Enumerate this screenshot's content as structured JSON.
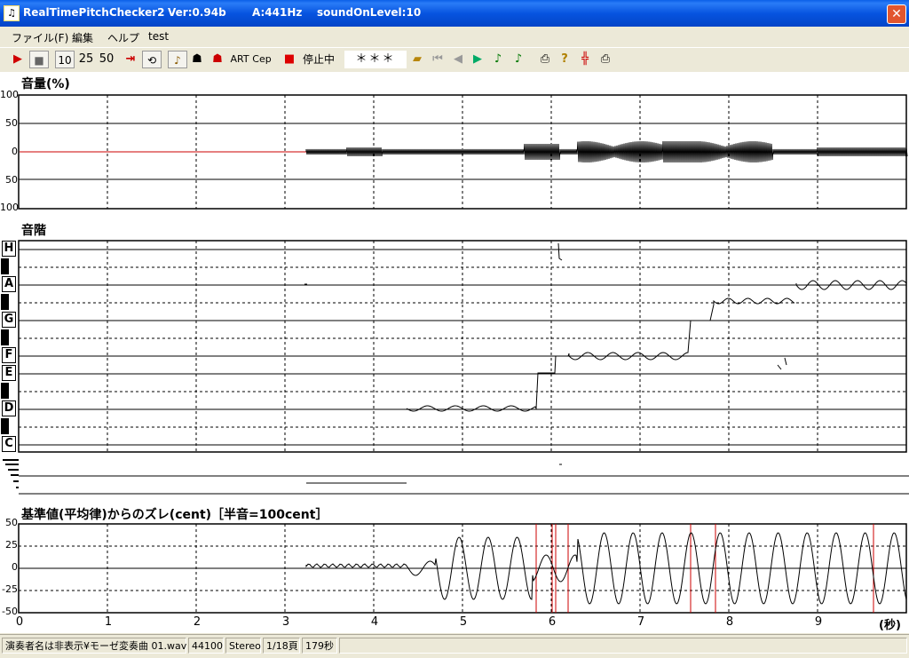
{
  "window": {
    "app_name": "RealTimePitchChecker2",
    "version": "Ver:0.94b",
    "a_freq": "A:441Hz",
    "sound_level": "soundOnLevel:10",
    "close_symbol": "✕"
  },
  "menu": [
    "ファイル(F)",
    "編集",
    "ヘルプ",
    "test"
  ],
  "toolbar": {
    "play_symbol": "▶",
    "stop_symbol": "■",
    "zoom_10": "10",
    "zoom_25": "25",
    "zoom_50": "50",
    "art_label": "ART",
    "cep_label": "Cep",
    "status_label": "停止中",
    "note_display": "＊＊＊",
    "icons": [
      "jump-end-icon",
      "loop-icon",
      "violin-icon",
      "singer-icon",
      "singer-red-icon",
      "record-icon",
      "folder-icon",
      "first-icon",
      "prev-icon",
      "next-icon",
      "note-green-icon",
      "note-green2-icon",
      "print-icon",
      "help-icon",
      "split-icon",
      "print2-icon"
    ]
  },
  "volume_panel": {
    "title": "音量(%)",
    "yticks": [
      "100",
      "50",
      "0",
      "50",
      "100"
    ]
  },
  "scale_panel": {
    "title": "音階",
    "notes": [
      "H",
      "A",
      "G",
      "F",
      "E",
      "D",
      "C"
    ]
  },
  "deviation_panel": {
    "title": "基準値(平均律)からのズレ(cent)［半音=100cent］",
    "yticks": [
      "50",
      "25",
      "0",
      "-25",
      "-50"
    ]
  },
  "time_axis": {
    "labels": [
      "0",
      "1",
      "2",
      "3",
      "4",
      "5",
      "6",
      "7",
      "8",
      "9"
    ],
    "unit": "(秒)"
  },
  "status": {
    "file": "演奏者名は非表示¥モーゼ変奏曲 01.wav",
    "rate": "44100",
    "channels": "Stereo",
    "page": "1/18頁",
    "duration": "179秒"
  },
  "colors": {
    "title_bar": "#0a5fe8",
    "plot_line": "#000000",
    "marker_red": "#cc0000"
  }
}
